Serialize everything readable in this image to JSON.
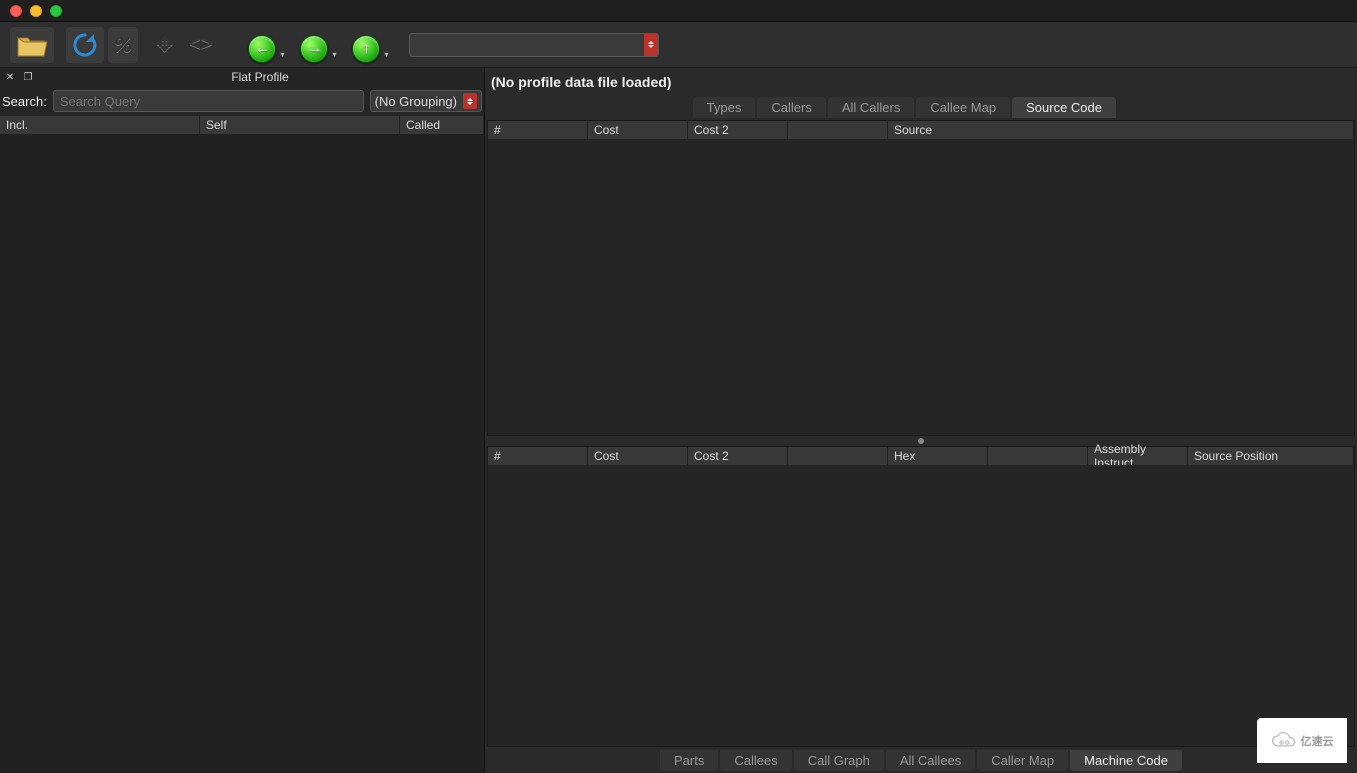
{
  "titlebar": {},
  "toolbar": {
    "combo_value": ""
  },
  "left_panel": {
    "dock_title": "Flat Profile",
    "search_label": "Search:",
    "search_placeholder": "Search Query",
    "search_value": "",
    "grouping_label": "(No Grouping)",
    "columns": [
      "Incl.",
      "Self",
      "Called"
    ]
  },
  "right_panel": {
    "heading": "(No profile data file loaded)",
    "top_tabs": [
      {
        "label": "Types",
        "active": false
      },
      {
        "label": "Callers",
        "active": false
      },
      {
        "label": "All Callers",
        "active": false
      },
      {
        "label": "Callee Map",
        "active": false
      },
      {
        "label": "Source Code",
        "active": true
      }
    ],
    "top_pane_columns": [
      "#",
      "Cost",
      "Cost 2",
      "",
      "Source"
    ],
    "bottom_pane_columns": [
      "#",
      "Cost",
      "Cost 2",
      "",
      "Hex",
      "",
      "Assembly Instruct",
      "Source Position"
    ],
    "bottom_tabs": [
      {
        "label": "Parts",
        "active": false
      },
      {
        "label": "Callees",
        "active": false
      },
      {
        "label": "Call Graph",
        "active": false
      },
      {
        "label": "All Callees",
        "active": false
      },
      {
        "label": "Caller Map",
        "active": false
      },
      {
        "label": "Machine Code",
        "active": true
      }
    ]
  },
  "watermark": "亿速云"
}
